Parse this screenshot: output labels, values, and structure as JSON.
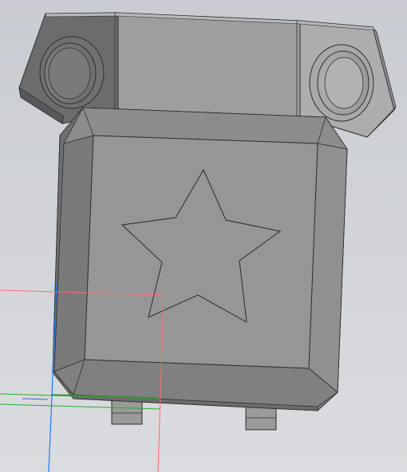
{
  "viewport": {
    "type": "cad-3d-view",
    "model": {
      "shape": "chamfered square plate with star engraving on a bracket with two round bosses",
      "engraving": "five-point star",
      "mount_bosses": 2,
      "tabs": 2
    },
    "axes_colors": {
      "x_axis": "#ff5a5a",
      "y_axis": "#2eaa2e",
      "z_axis": "#1e78ff"
    },
    "colors": {
      "background_top": "#c9ccd2",
      "background_bottom": "#d9dbdf",
      "body": "#9b9b9b",
      "body_dark": "#6a6a6a",
      "body_light": "#b5b5b5",
      "edge": "#2f2f2f",
      "bevel_left": "#757575",
      "bevel_top": "#8a8a8a",
      "bevel_right": "#8e8e8e",
      "bevel_bottom": "#7c7c7c",
      "face": "#959595"
    }
  }
}
